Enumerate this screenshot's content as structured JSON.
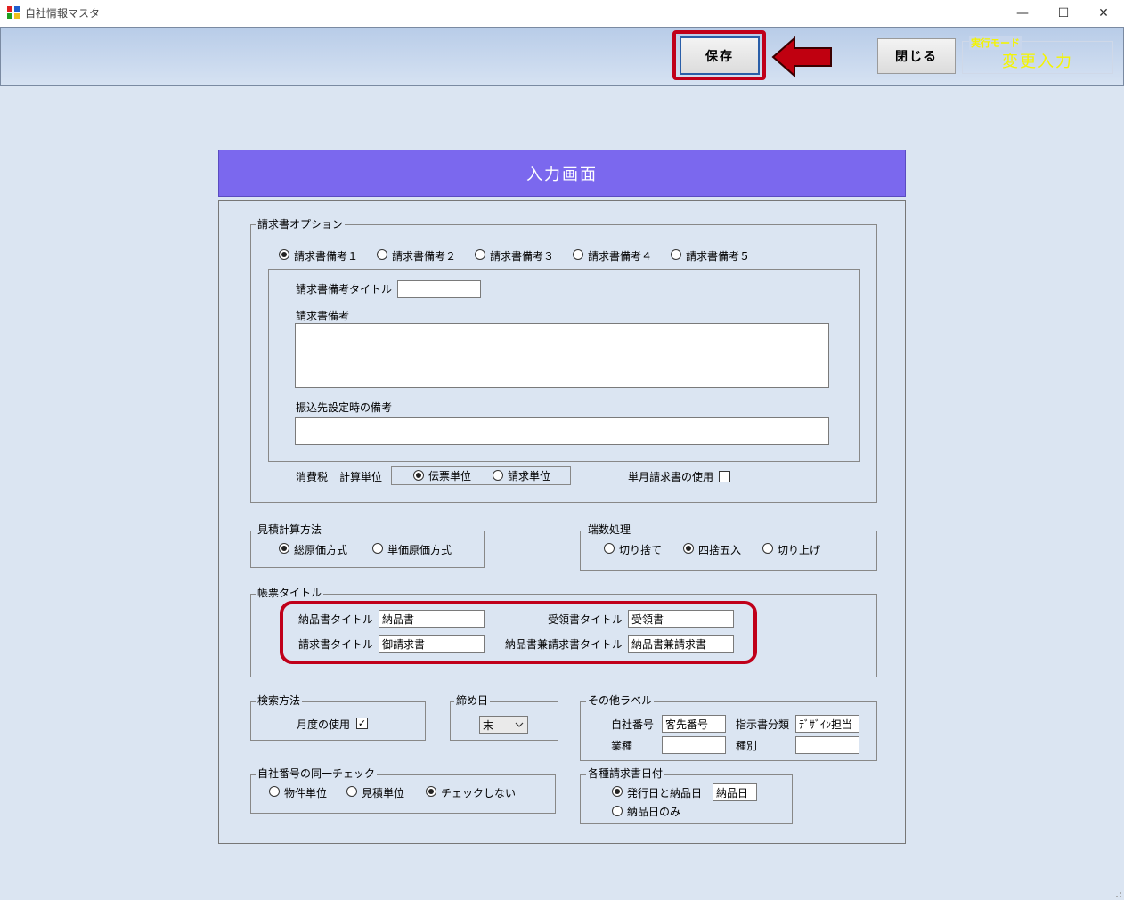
{
  "window": {
    "title": "自社情報マスタ",
    "minimize": "—",
    "maximize": "☐",
    "close": "✕"
  },
  "toolbar": {
    "save_label": "保存",
    "close_label": "閉じる",
    "mode_label": "実行モード",
    "mode_value": "変更入力"
  },
  "header": {
    "title": "入力画面"
  },
  "invoice_options": {
    "label": "請求書オプション",
    "radios": [
      "請求書備考１",
      "請求書備考２",
      "請求書備考３",
      "請求書備考４",
      "請求書備考５"
    ],
    "selected_index": 0,
    "remark_title_label": "請求書備考タイトル",
    "remark_title_value": "",
    "remark_label": "請求書備考",
    "remark_value": "",
    "transfer_remark_label": "振込先設定時の備考",
    "transfer_remark_value": "",
    "tax_label": "消費税",
    "calc_unit_label": "計算単位",
    "calc_unit_options": [
      "伝票単位",
      "請求単位"
    ],
    "calc_unit_selected": 0,
    "single_month_label": "単月請求書の使用",
    "single_month_checked": false
  },
  "estimate_method": {
    "label": "見積計算方法",
    "options": [
      "総原価方式",
      "単価原価方式"
    ],
    "selected": 0
  },
  "rounding": {
    "label": "端数処理",
    "options": [
      "切り捨て",
      "四捨五入",
      "切り上げ"
    ],
    "selected": 1
  },
  "form_titles": {
    "label": "帳票タイトル",
    "delivery_label": "納品書タイトル",
    "delivery_value": "納品書",
    "receipt_label": "受領書タイトル",
    "receipt_value": "受領書",
    "invoice_label": "請求書タイトル",
    "invoice_value": "御請求書",
    "combo_label": "納品書兼請求書タイトル",
    "combo_value": "納品書兼請求書"
  },
  "search_method": {
    "label": "検索方法",
    "month_usage_label": "月度の使用",
    "month_usage_checked": true
  },
  "closing_day": {
    "label": "締め日",
    "value": "末"
  },
  "other_labels": {
    "label": "その他ラベル",
    "company_no_label": "自社番号",
    "company_no_value": "客先番号",
    "instruction_label": "指示書分類",
    "instruction_value": "ﾃﾞｻﾞｲﾝ担当",
    "industry_label": "業種",
    "industry_value": "",
    "type_label": "種別",
    "type_value": ""
  },
  "duplicate_check": {
    "label": "自社番号の同一チェック",
    "options": [
      "物件単位",
      "見積単位",
      "チェックしない"
    ],
    "selected": 2
  },
  "invoice_dates": {
    "label": "各種請求書日付",
    "options": [
      "発行日と納品日",
      "納品日のみ"
    ],
    "selected": 0,
    "value": "納品日"
  },
  "colors": {
    "header_bg": "#7b68ee",
    "highlight": "#c0001a",
    "mode_text": "#f4f400"
  }
}
